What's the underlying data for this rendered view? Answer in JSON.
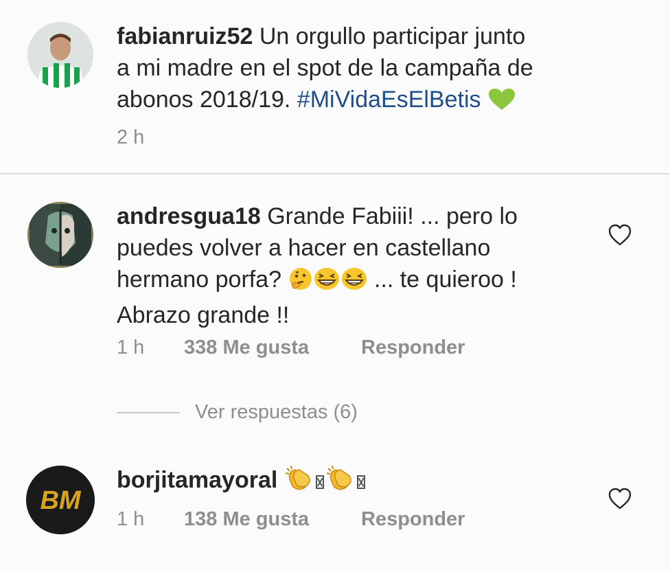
{
  "caption": {
    "username": "fabianruiz52",
    "line1": " Un orgullo participar junto",
    "line2": "a mi madre en el spot de la campaña de",
    "line3_text": "abonos 2018/19. ",
    "hashtag": "#MiVidaEsElBetis",
    "emoji": "green-heart",
    "time": "2 h"
  },
  "comments": [
    {
      "username": "andresgua18",
      "line1": " Grande Fabiii! ... pero lo",
      "line2": "puedes volver a hacer en castellano",
      "line3_pre": "hermano porfa? ",
      "emojis": [
        "thinking-face",
        "grinning-squinting-face",
        "grinning-squinting-face"
      ],
      "line3_post": " ... te quieroo !",
      "line4": "Abrazo grande !!",
      "time": "1 h",
      "likes": "338 Me gusta",
      "reply": "Responder",
      "view_replies": "Ver respuestas (6)"
    },
    {
      "username": "borjitamayoral",
      "emojis": [
        "clapping-hands",
        "missing-glyph",
        "clapping-hands",
        "missing-glyph"
      ],
      "avatar_text": "BM",
      "time": "1 h",
      "likes": "138 Me gusta",
      "reply": "Responder"
    }
  ],
  "colors": {
    "text": "#262626",
    "secondary": "#8e8e8e",
    "hashtag": "#1f4f8a",
    "heart": "#8cc63f",
    "divider": "#dbdbdb",
    "avatar_bm_bg": "#1a1a1a",
    "avatar_bm_text": "#d9a520"
  }
}
